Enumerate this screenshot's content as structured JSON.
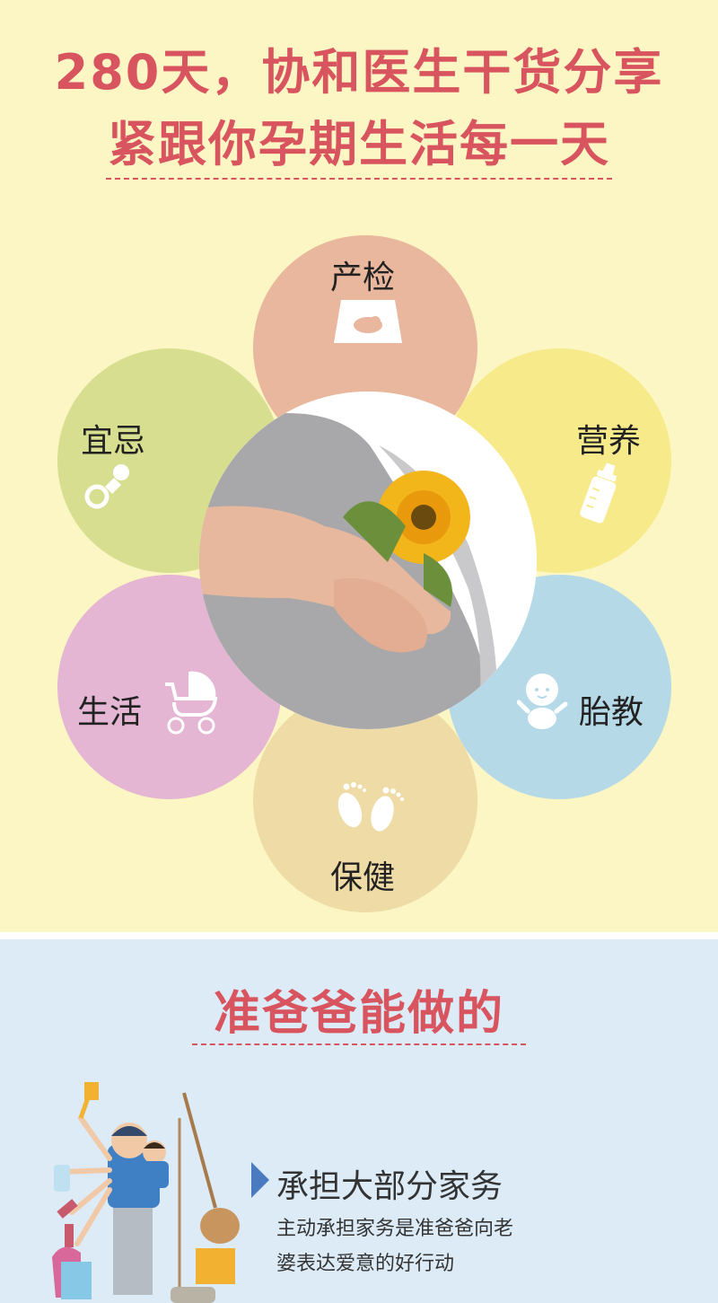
{
  "header": {
    "title_line1": "280天，协和医生干货分享",
    "title_line2": "紧跟你孕期生活每一天"
  },
  "petals": {
    "chanjian": {
      "label": "产检",
      "icon": "ultrasound-icon",
      "color": "#e9b79d"
    },
    "yingyang": {
      "label": "营养",
      "icon": "baby-bottle-icon",
      "color": "#f7ea8a"
    },
    "taijiao": {
      "label": "胎教",
      "icon": "baby-icon",
      "color": "#b6d9e8"
    },
    "baojian": {
      "label": "保健",
      "icon": "footprints-icon",
      "color": "#eedba5"
    },
    "shenghuo": {
      "label": "生活",
      "icon": "stroller-icon",
      "color": "#e4b6d3"
    },
    "yiji": {
      "label": "宜忌",
      "icon": "pacifier-icon",
      "color": "#d7de8f"
    }
  },
  "section2": {
    "title": "准爸爸能做的",
    "item": {
      "title": "承担大部分家务",
      "body_line1": "主动承担家务是准爸爸向老",
      "body_line2": "婆表达爱意的好行动"
    }
  },
  "colors": {
    "accent": "#d85560",
    "top_bg": "#fbf6c3",
    "bottom_bg": "#dcebf6",
    "arrow": "#4a7bc1"
  }
}
